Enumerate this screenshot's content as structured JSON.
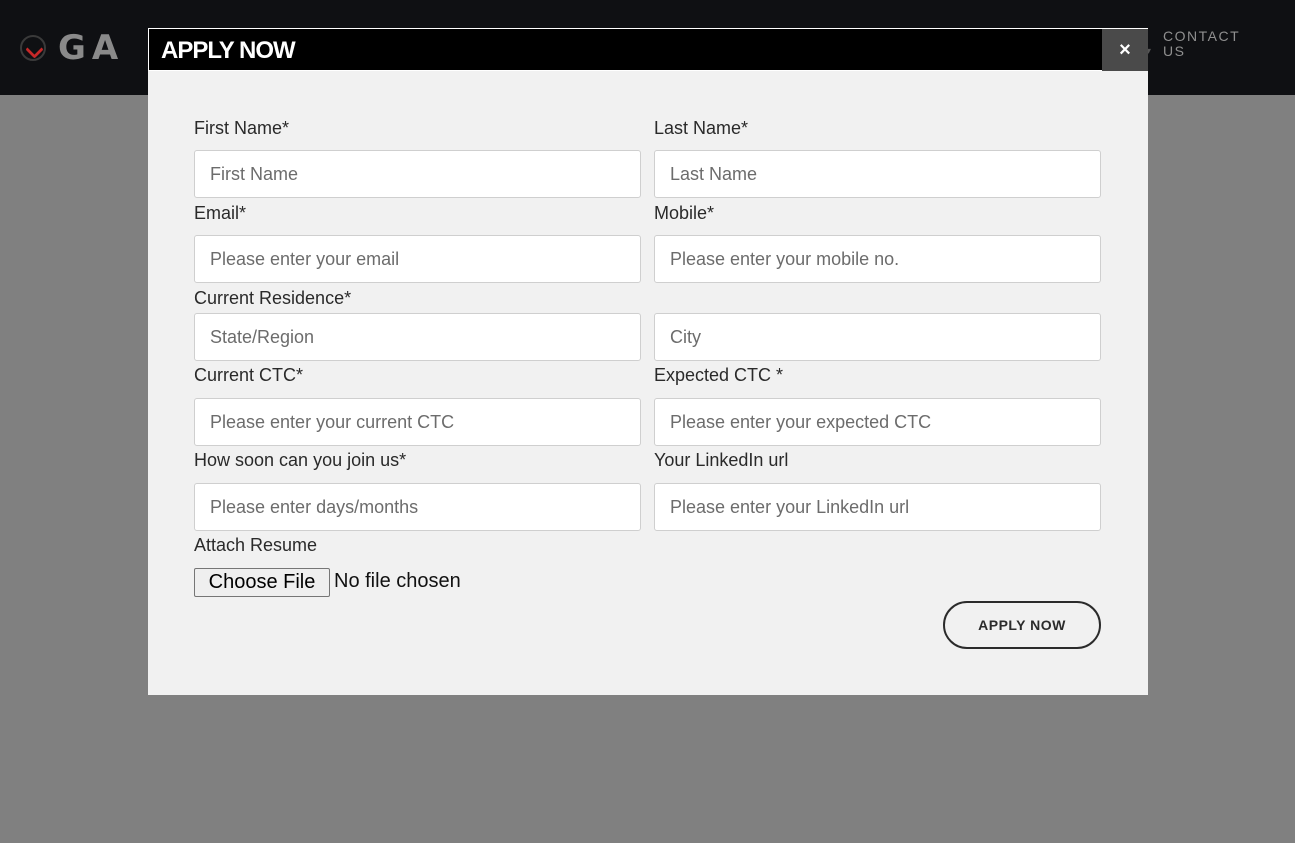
{
  "navbar": {
    "logo_text": "GA",
    "contact_link": "CONTACT US"
  },
  "modal": {
    "title": "APPLY NOW",
    "close_label": "×",
    "fields": {
      "first_name": {
        "label": "First Name*",
        "placeholder": "First Name"
      },
      "last_name": {
        "label": "Last Name*",
        "placeholder": "Last Name"
      },
      "email": {
        "label": "Email*",
        "placeholder": "Please enter your email"
      },
      "mobile": {
        "label": "Mobile*",
        "placeholder": "Please enter your mobile no."
      },
      "residence": {
        "label": "Current Residence*",
        "state_placeholder": "State/Region",
        "city_placeholder": "City"
      },
      "current_ctc": {
        "label": "Current CTC*",
        "placeholder": "Please enter your current CTC"
      },
      "expected_ctc": {
        "label": "Expected CTC *",
        "placeholder": "Please enter your expected CTC"
      },
      "join": {
        "label": "How soon can you join us*",
        "placeholder": "Please enter days/months"
      },
      "linkedin": {
        "label": "Your LinkedIn url",
        "placeholder": "Please enter your LinkedIn url"
      },
      "resume": {
        "label": "Attach Resume",
        "button_label": "Choose File",
        "status": "No file chosen"
      }
    },
    "submit_label": "APPLY NOW"
  },
  "colors": {
    "navbar_bg": "#0f1013",
    "overlay": "#808080",
    "modal_bg": "#f1f1f1",
    "header_bg": "#000000",
    "close_bg": "#4a4a4a"
  }
}
